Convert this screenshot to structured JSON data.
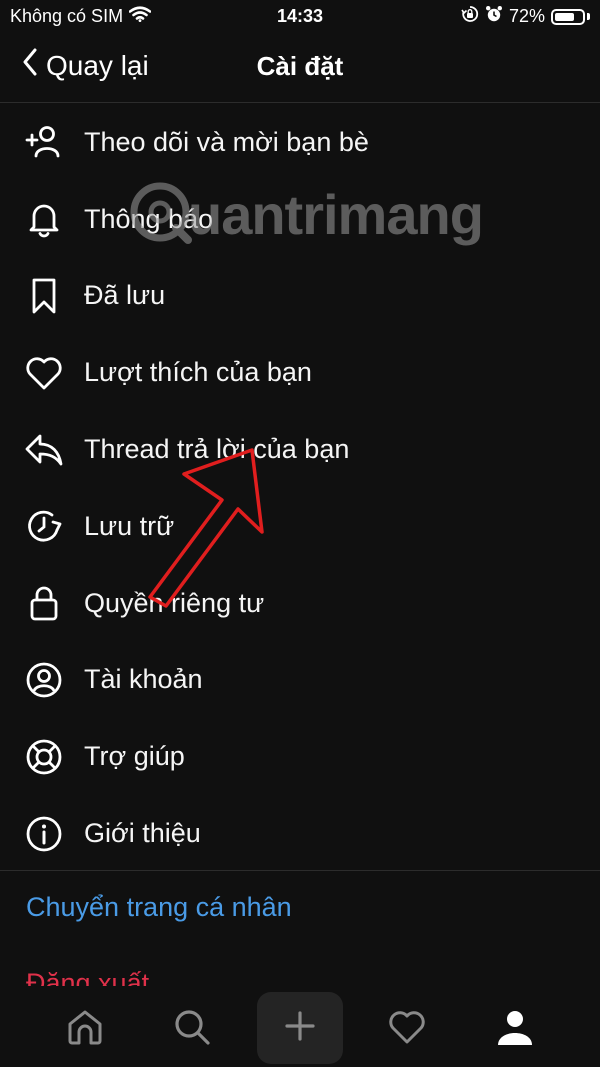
{
  "status_bar": {
    "carrier": "Không có SIM",
    "time": "14:33",
    "battery_percent": "72%",
    "battery_level": 0.72,
    "icons": [
      "wifi-icon",
      "orientation-lock-icon",
      "alarm-icon",
      "battery-icon"
    ]
  },
  "nav": {
    "back_label": "Quay lại",
    "title": "Cài đặt"
  },
  "menu": {
    "items": [
      {
        "label": "Theo dõi và mời bạn bè",
        "icon": "add-person-icon"
      },
      {
        "label": "Thông báo",
        "icon": "bell-icon"
      },
      {
        "label": "Đã lưu",
        "icon": "bookmark-icon"
      },
      {
        "label": "Lượt thích của bạn",
        "icon": "heart-icon"
      },
      {
        "label": "Thread trả lời của bạn",
        "icon": "reply-icon"
      },
      {
        "label": "Lưu trữ",
        "icon": "archive-clock-icon"
      },
      {
        "label": "Quyền riêng tư",
        "icon": "lock-icon"
      },
      {
        "label": "Tài khoản",
        "icon": "account-icon"
      },
      {
        "label": "Trợ giúp",
        "icon": "lifebuoy-icon"
      },
      {
        "label": "Giới thiệu",
        "icon": "info-icon"
      }
    ]
  },
  "links": {
    "switch_profile": "Chuyển trang cá nhân",
    "logout": "Đăng xuất"
  },
  "tab_bar": {
    "tabs": [
      "home-icon",
      "search-icon",
      "create-icon",
      "activity-heart-icon",
      "profile-icon"
    ]
  },
  "watermark": {
    "text": "uantrimang"
  },
  "colors": {
    "background": "#101010",
    "link_blue": "#4a9be6",
    "logout_red": "#e0314a",
    "annotation_arrow": "#e01e1e"
  }
}
